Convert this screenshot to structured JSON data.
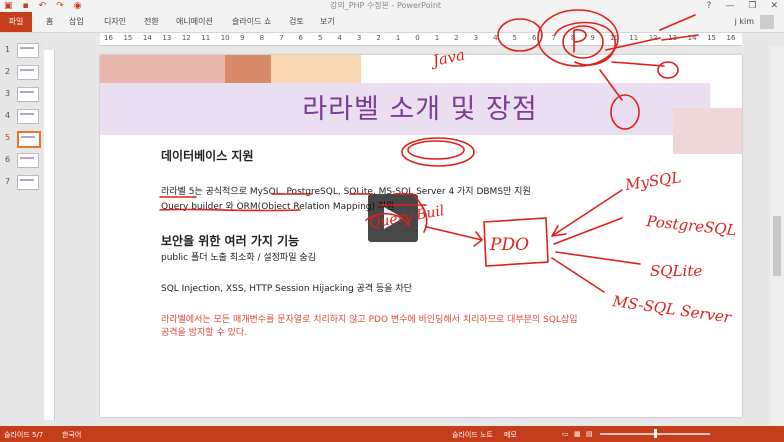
{
  "titlebar": {
    "document": "강의_PHP 수정본 - PowerPoint",
    "window_controls": [
      "?",
      "—",
      "❐",
      "✕"
    ]
  },
  "ribbon": {
    "tabs": [
      "파일",
      "홈",
      "삽입",
      "디자인",
      "전환",
      "애니메이션",
      "슬라이드 쇼",
      "검토",
      "보기"
    ],
    "user": "j kim"
  },
  "thumbnails": [
    "1",
    "2",
    "3",
    "4",
    "5",
    "6",
    "7"
  ],
  "active_slide": 5,
  "ruler": [
    "16",
    "15",
    "14",
    "13",
    "12",
    "11",
    "10",
    "9",
    "8",
    "7",
    "6",
    "5",
    "4",
    "3",
    "2",
    "1",
    "0",
    "1",
    "2",
    "3",
    "4",
    "5",
    "6",
    "7",
    "8",
    "9",
    "10",
    "11",
    "12",
    "13",
    "14",
    "15",
    "16"
  ],
  "slide": {
    "title": "라라벨 소개 및 장점",
    "db_heading": "데이터베이스 지원",
    "db_line1": "라라벨 5는 공식적으로 MySQL, PostgreSQL, SQLite, MS-SQL Server 4 가지 DBMS만 지원",
    "db_line2": "Query builder 와 ORM(Object Relation Mapping) 지원",
    "sec_heading": "보안을 위한 여러 가지 기능",
    "sec_line1": "public 폴더 노출 최소화 / 설정파일 숨김",
    "sec_line2": "SQL Injection, XSS, HTTP Session Hijacking 공격 등을 차단",
    "note_line1": "라라벨에서는 모든 매개변수를 문자열로 치리하지 않고 PDO 변수에 바인딩해서 치리하므로 대부분의 SQL삽입",
    "note_line2": "공격을 방지할 수 있다."
  },
  "status": {
    "slide_info": "슬라이드 5/7",
    "language": "한국어",
    "notes": "슬라이드 노트",
    "comments": "메모"
  },
  "colors": {
    "accent": "#c43e1c",
    "title": "#7b3e92",
    "ink": "#e0201a"
  },
  "annotations": [
    "Java",
    "MySQL",
    "PostgreSQL",
    "SQLite",
    "MS-SQL Server",
    "PDO",
    "Query Buil"
  ]
}
